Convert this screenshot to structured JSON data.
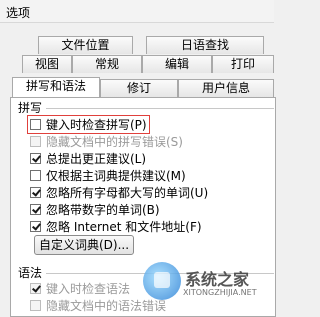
{
  "window": {
    "title": "选项"
  },
  "tabs": {
    "row1": [
      "文件位置",
      "日语查找"
    ],
    "row2": [
      "视图",
      "常规",
      "编辑",
      "打印"
    ],
    "row3": [
      "拼写和语法",
      "修订",
      "用户信息"
    ]
  },
  "spelling": {
    "section_label": "拼写",
    "options": [
      {
        "label": "键入时检查拼写(P)",
        "checked": false,
        "disabled": false
      },
      {
        "label": "隐藏文档中的拼写错误(S)",
        "checked": false,
        "disabled": true
      },
      {
        "label": "总提出更正建议(L)",
        "checked": true,
        "disabled": false
      },
      {
        "label": "仅根据主词典提供建议(M)",
        "checked": false,
        "disabled": false
      },
      {
        "label": "忽略所有字母都大写的单词(U)",
        "checked": true,
        "disabled": false
      },
      {
        "label": "忽略带数字的单词(B)",
        "checked": true,
        "disabled": false
      },
      {
        "label": "忽略 Internet 和文件地址(F)",
        "checked": true,
        "disabled": false
      }
    ],
    "custom_dict_button": "自定义词典(D)..."
  },
  "grammar": {
    "section_label": "语法",
    "options": [
      {
        "label": "键入时检查语法",
        "checked": true,
        "disabled": true
      },
      {
        "label": "隐藏文档中的语法错误",
        "checked": false,
        "disabled": true
      }
    ]
  },
  "watermark": {
    "brand": "系统之家",
    "url": "XITONGZHIJIA.NET"
  }
}
